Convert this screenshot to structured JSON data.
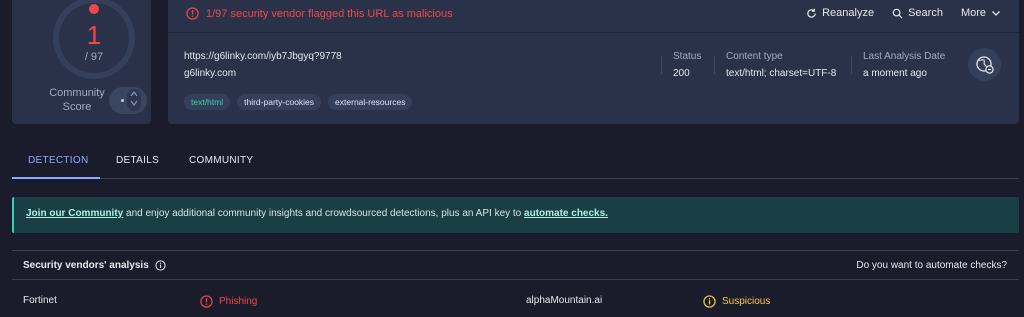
{
  "score": {
    "detections": "1",
    "total": "/ 97",
    "community_label": "Community\nScore",
    "community_value": "·"
  },
  "banner": {
    "alert_text": "1/97 security vendor flagged this URL as malicious",
    "actions": {
      "reanalyze": "Reanalyze",
      "search": "Search",
      "more": "More"
    }
  },
  "resource": {
    "url": "https://g6linky.com/iyb7Jbgyq?9778",
    "domain": "g6linky.com",
    "tags": [
      "text/html",
      "third-party-cookies",
      "external-resources"
    ]
  },
  "meta": {
    "status_label": "Status",
    "status_value": "200",
    "content_type_label": "Content type",
    "content_type_value": "text/html; charset=UTF-8",
    "last_analysis_label": "Last Analysis Date",
    "last_analysis_value": "a moment ago"
  },
  "tabs": [
    "DETECTION",
    "DETAILS",
    "COMMUNITY"
  ],
  "promo": {
    "link1": "Join our Community",
    "middle": " and enjoy additional community insights and crowdsourced detections, plus an API key to ",
    "link2": "automate checks."
  },
  "vendors": {
    "title": "Security vendors' analysis",
    "automate_prompt": "Do you want to automate checks?",
    "rows": [
      {
        "vendor1": "Fortinet",
        "result1": "Phishing",
        "vendor2": "alphaMountain.ai",
        "result2": "Suspicious"
      }
    ]
  },
  "colors": {
    "malicious": "#f0484a",
    "suspicious": "#f5c84c",
    "accent": "#8fa8ff",
    "clean_tag": "#35d4a7"
  }
}
